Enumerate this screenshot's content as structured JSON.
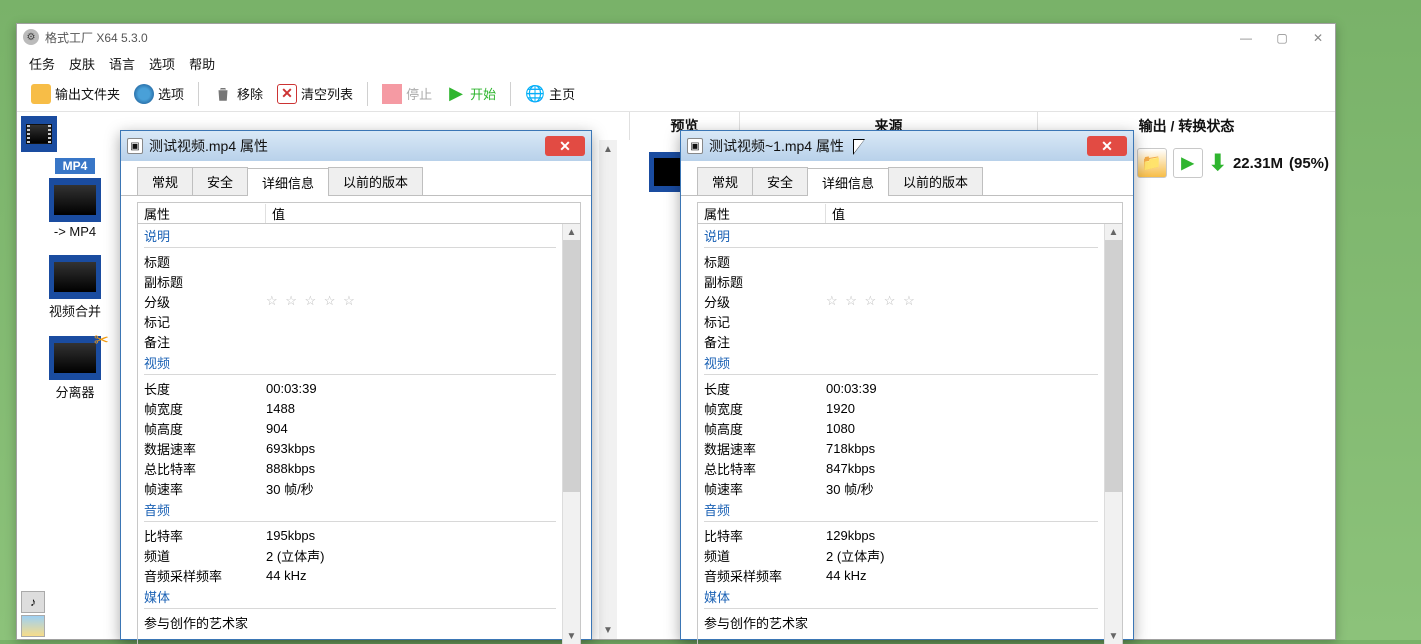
{
  "window": {
    "title": "格式工厂 X64 5.3.0"
  },
  "menu": [
    "任务",
    "皮肤",
    "语言",
    "选项",
    "帮助"
  ],
  "toolbar": {
    "out_folder": "输出文件夹",
    "options": "选项",
    "remove": "移除",
    "clear": "清空列表",
    "stop": "停止",
    "start": "开始",
    "home": "主页"
  },
  "columns": {
    "preview": "预览",
    "source": "来源",
    "status": "输出 / 转换状态"
  },
  "sidebar": {
    "mp4": "-> MP4",
    "merge": "视频合并",
    "splitter": "分离器"
  },
  "right": {
    "size": "22.31M",
    "percent": "(95%)"
  },
  "prop_tabs": [
    "常规",
    "安全",
    "详细信息",
    "以前的版本"
  ],
  "prop_header": {
    "attr": "属性",
    "val": "值"
  },
  "sections": {
    "desc": "说明",
    "video": "视频",
    "audio": "音频",
    "media": "媒体"
  },
  "labels": {
    "title": "标题",
    "subtitle": "副标题",
    "rating": "分级",
    "tag": "标记",
    "note": "备注",
    "length": "长度",
    "fwidth": "帧宽度",
    "fheight": "帧高度",
    "drate": "数据速率",
    "tbrate": "总比特率",
    "frate": "帧速率",
    "abrate": "比特率",
    "channels": "频道",
    "asample": "音频采样频率",
    "artists": "参与创作的艺术家"
  },
  "stars": "☆ ☆ ☆ ☆ ☆",
  "dialog1": {
    "title": "测试视频.mp4 属性",
    "video": {
      "length": "00:03:39",
      "fwidth": "1488",
      "fheight": "904",
      "drate": "693kbps",
      "tbrate": "888kbps",
      "frate": "30 帧/秒"
    },
    "audio": {
      "abrate": "195kbps",
      "channels": "2 (立体声)",
      "asample": "44 kHz"
    }
  },
  "dialog2": {
    "title": "测试视频~1.mp4 属性",
    "video": {
      "length": "00:03:39",
      "fwidth": "1920",
      "fheight": "1080",
      "drate": "718kbps",
      "tbrate": "847kbps",
      "frate": "30 帧/秒"
    },
    "audio": {
      "abrate": "129kbps",
      "channels": "2 (立体声)",
      "asample": "44 kHz"
    }
  }
}
